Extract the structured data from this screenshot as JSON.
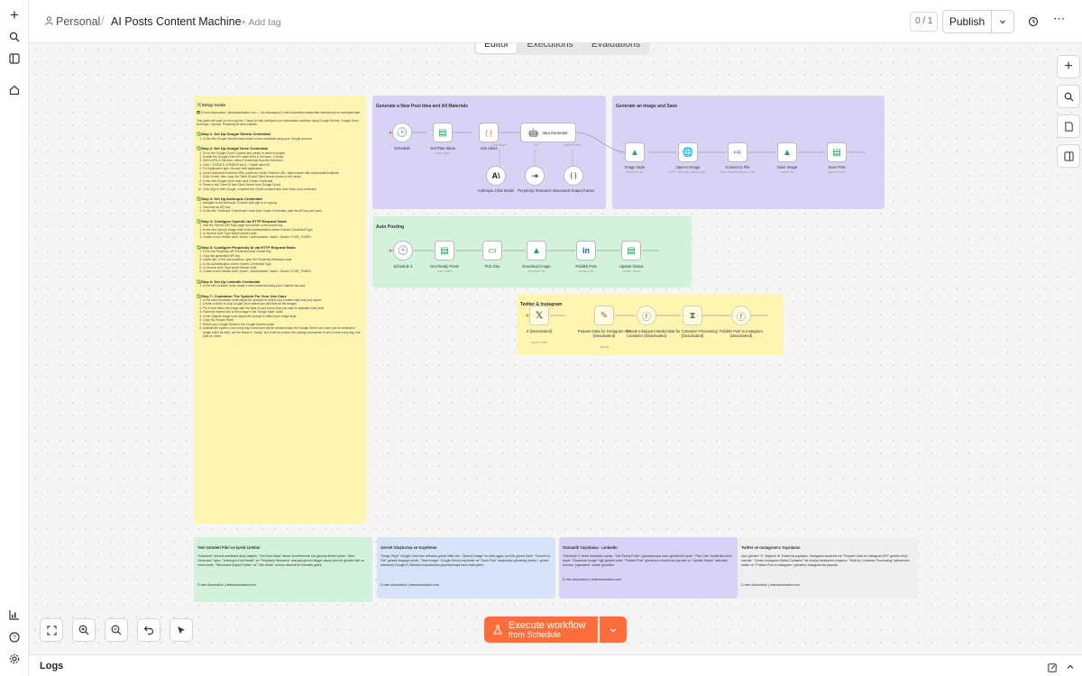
{
  "breadcrumb": {
    "scope": "Personal",
    "separator": "/",
    "workflow_name": "AI Posts Content Machine",
    "add_tag": "+ Add tag"
  },
  "header": {
    "version_count": "0 / 1",
    "publish_label": "Publish"
  },
  "tabs": [
    "Editor",
    "Executions",
    "Evaluations"
  ],
  "canvas": {
    "setup_guide": {
      "title": "🛠️Setup Guide",
      "intro": "🧑‍💻 D-mim Automation | dmimautomation.com — Bu otomasyon D-mim Automation tarafından hazırlanmış ve markalanmıştır.",
      "desc": "This guide will walk you through the 7 steps to fully configure your automation workflow using Google Sheets, Google Drive, Anthropic, OpenAI, Perplexity AI and LinkedIn.",
      "steps": [
        {
          "title": "✅Step 1: Set Up Google Sheets Credential",
          "items": [
            "In the n8n Google Sheets node create a new credential using your Google account"
          ]
        },
        {
          "title": "✅Step 2: Set Up Google Drive Credential",
          "items": [
            "Go to the Google Cloud Console and create or select a project",
            "Enable the Google Drive API under APIs & Services > Library",
            "Still in APIs & Services, select Credentials from the left menu",
            "Click + CREATE CREDENTIALS > OAuth client ID",
            "For Application type, choose Web application",
            "Under Authorized redirect URIs, paste the OAuth Redirect URL: https://oauth.n8n.cloud/oauth2/callback",
            "Click Create, then copy the Client ID and Client Secret shown in the modal",
            "In the n8n Google Drive node click Create Credential",
            "Paste in the Client ID and Client Secret from Google Cloud",
            "Click Sign in with Google, complete the OAuth consent flow, then Save your credential"
          ]
        },
        {
          "title": "✅Step 3: Set Up Anthropic Credential",
          "items": [
            "Navigate to the Anthropic Console and sign in or sign up",
            "Generate an API key",
            "In the n8n \"Anthropic Chat Model\" node click Create Credential, past the API key and save"
          ]
        },
        {
          "title": "✅Step 4: Configure OpenAI via HTTP Request Node",
          "items": [
            "Visit the OpenAI API Keys page and create a new secret key",
            "In the n8n OpenAI Image node in the Authentication select Generic Credential Type",
            "In Generic Auth Type select Header Auth",
            "Create a new Header Auth, Name = Authorization, Value = Bearer YOUR_TOKEN"
          ]
        },
        {
          "title": "✅Step 5: Configure Perplexity AI via HTTP Request Node",
          "items": [
            "Go to the Perplexity API Portal and click Create Key",
            "Copy the generated API key",
            "Inside n8n, in the sub-workflow, open the Perplexity Research node",
            "In the Authentication select Generic Credential Type",
            "In Generic Auth Type select Header Auth",
            "Create a new Header Auth, Name = Authorization, Value = Bearer YOUR_TOKEN"
          ]
        },
        {
          "title": "✅Step 6: Set Up LinkedIn Credential",
          "items": [
            "In the n8n LinkedIn node create a new credential using your LinkedIn account"
          ]
        },
        {
          "title": "✅Step 7: Customize The System For Your Use Case",
          "items": [
            "In the Idea Generator node adjust the prompts to reflect your content style and your topics",
            "Create a folder in your Google Drive where you will store all the images",
            "Put in that folder the image with the style of your brand, that you want to replicate every time",
            "Paste the shared link to this image in the \"Image Style\" node",
            "In the OpenAI Image node adjust the prompt to reflect your image style",
            "Copy my Google Sheet",
            "Select your Google Sheet in the Google Sheets nodes",
            "Activate the system, now every day a new post will be created inside the Google Sheet, and once you've reviewed it (might edit it as well), set the status to \"ready\" and it will be posted, the posting mechanism is set to work every day, one post at a time."
          ]
        }
      ]
    },
    "groups": {
      "generate": "Generate a New Post Idea and All Materials",
      "image": "Generate an Image and Save",
      "auto": "Auto Posting",
      "twitter": "Twitter & Instagram"
    },
    "nodes": {
      "schedule": {
        "label": "Schedule",
        "icon": "clock-icon"
      },
      "get_past_ideas": {
        "label": "Get Past Ideas",
        "sub": "read: sheet",
        "icon": "sheets-icon"
      },
      "join_ideas": {
        "label": "Join Ideas",
        "icon": "code-icon"
      },
      "idea_generator": {
        "label": "Idea Generator",
        "icon": "robot-icon",
        "ports": [
          "Chat Model*",
          "Tool",
          "Output Parser"
        ]
      },
      "anthropic": {
        "label": "Anthropic Chat Model",
        "icon": "anthropic-icon"
      },
      "perplexity": {
        "label": "Perplexity Research",
        "icon": "arrow-icon"
      },
      "parser": {
        "label": "Structured Output Parser",
        "icon": "braces-icon"
      },
      "image_style": {
        "label": "Image Style",
        "sub": "download: file",
        "icon": "drive-icon"
      },
      "openai_image": {
        "label": "OpenAI Image",
        "sub": "POST: https://api.openai.com...",
        "icon": "globe-icon"
      },
      "convert_file": {
        "label": "Convert to File",
        "sub": "Move Base64 String to File",
        "icon": "file-convert-icon"
      },
      "save_image": {
        "label": "Save Image",
        "sub": "upload: file",
        "icon": "drive-icon"
      },
      "save_post": {
        "label": "Save Post",
        "sub": "append: sheet",
        "icon": "sheets-icon"
      },
      "schedule2": {
        "label": "Schedule 2",
        "icon": "clock-icon"
      },
      "get_ready_posts": {
        "label": "Get Ready Posts",
        "sub": "read: sheet",
        "icon": "sheets-icon"
      },
      "pick_one": {
        "label": "Pick One",
        "icon": "limit-icon"
      },
      "download_image": {
        "label": "Download Image",
        "sub": "download: file",
        "icon": "drive-icon"
      },
      "publish_post": {
        "label": "Publish Post",
        "sub": "create: post",
        "icon": "linkedin-icon"
      },
      "update_status": {
        "label": "Update Status",
        "sub": "update: sheet",
        "icon": "sheets-icon"
      },
      "x": {
        "label": "X (Deactivated)",
        "sub": "create: tweet",
        "icon": "x-icon"
      },
      "prepare_ig": {
        "label": "Prepare Data for Instagram API (Deactivated)",
        "sub": "manual",
        "icon": "pencil-icon"
      },
      "create_container": {
        "label": "Create Instagram Media Container (Deactivated)",
        "icon": "facebook-icon"
      },
      "wait_container": {
        "label": "Wait for Container Processing (Deactivated)",
        "icon": "hourglass-icon"
      },
      "publish_ig": {
        "label": "Publish Post to Instagram (Deactivated)",
        "icon": "facebook-icon"
      }
    },
    "notes": [
      {
        "title": "Yeni Gönderi Fikri ve İçerik Üretimi",
        "text": "\"Schedule\" düzenli aralıklarla akışı başlatır, \"Get Past Ideas\" tekrar önerilmemesi için geçmiş fikirleri çeker. \"Idea Generator\" ajanı, \"Anthropic Chat Model\" ve \"Perplexity Research\" aracıyla güncel bilgiye dayalı yeni bir gönderi fikri ve metni üretir; \"Structured Output Parser\" ve \"Join Ideas\" sonucu düzenli bir formatta getirir.",
        "footer": "D-mim Automation | dmimautomation.com"
      },
      {
        "title": "Görsel Oluşturma ve Kaydetme",
        "text": "\"Image Style\" Google Drive'dan referans görsel stilini alır, \"OpenAI Image\" bu stile uygun yeni bir görsel üretir. \"Convert to File\" görseli dosyaya çevirir, \"Save Image\" Google Drive'a kaydeder ve \"Save Post\" oluşturulan gönderiyi (metin + görsel referansı) Google E-Tablolar'a kaydederek yayınlanmaya hazır hale getirir.",
        "footer": "D-mim Automation | dmimautomation.com"
      },
      {
        "title": "Otomatik Yayınlama - LinkedIn",
        "text": "\"Schedule 2\" belirli aralıklarla çalışır, \"Get Ready Posts\" yayınlanmaya hazır gönderileri çeker, \"Pick One\" bunlardan birini seçer. \"Download Image\" ilgili görseli indirir, \"Publish Post\" gönderiyi LinkedIn'de yayınlar ve \"Update Status\" tablodaki durumu \"yayınlandı\" olarak günceller.",
        "footer": "D-mim Automation | dmimautomation.com"
      },
      {
        "title": "Twitter ve Instagram'a Yayınlama",
        "text": "Aynı gönderi \"X\" düğümü ile Twitter'da paylaşılır. Instagram tarafında ise \"Prepare Data for Instagram API\" gerekli veriyi hazırlar, \"Create Instagram Media Container\" bir medya konteyneri oluşturur, \"Wait for Container Processing\" işlenmesini bekler ve \"Publish Post to Instagram\" gönderiyi Instagram'da yayınlar.",
        "footer": "D-mim Automation | dmimautomation.com"
      }
    ]
  },
  "execute": {
    "label": "Execute workflow",
    "sub": "from Schedule"
  },
  "footer": {
    "logs_label": "Logs"
  },
  "colors": {
    "accent": "#ff6d3a",
    "sticky_yellow": "#fff5b1",
    "sticky_purple": "#d9d2f7",
    "sticky_green": "#d2f2dc",
    "sticky_blue": "#d6e3f8"
  }
}
